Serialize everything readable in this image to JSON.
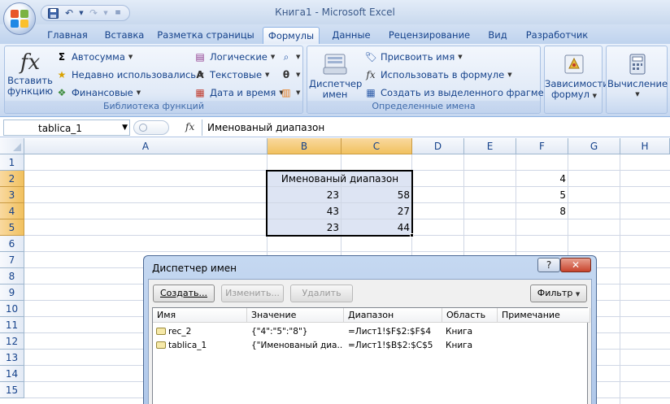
{
  "window": {
    "title": "Книга1 - Microsoft Excel"
  },
  "qat": {
    "save_icon": "save-icon",
    "undo_icon": "undo-icon",
    "redo_icon": "redo-icon",
    "customize_icon": "customize-icon"
  },
  "tabs": [
    {
      "label": "Главная"
    },
    {
      "label": "Вставка"
    },
    {
      "label": "Разметка страницы"
    },
    {
      "label": "Формулы",
      "active": true
    },
    {
      "label": "Данные"
    },
    {
      "label": "Рецензирование"
    },
    {
      "label": "Вид"
    },
    {
      "label": "Разработчик"
    }
  ],
  "ribbon": {
    "library": {
      "label": "Библиотека функций",
      "insert_function": "Вставить функцию",
      "insert_function_l1": "Вставить",
      "insert_function_l2": "функцию",
      "autosum": "Автосумма",
      "recent": "Недавно использовались",
      "financial": "Финансовые",
      "logical": "Логические",
      "text": "Текстовые",
      "datetime": "Дата и время"
    },
    "names": {
      "label": "Определенные имена",
      "manager_l1": "Диспетчер",
      "manager_l2": "имен",
      "define": "Присвоить имя",
      "use_in_formula": "Использовать в формуле",
      "create_from_selection": "Создать из выделенного фрагмента"
    },
    "dependencies": {
      "l1": "Зависимости",
      "l2": "формул"
    },
    "calculation": {
      "l1": "Вычисление"
    }
  },
  "formula_bar": {
    "name_box": "tablica_1",
    "fx": "fx",
    "formula": "Именованый диапазон"
  },
  "sheet": {
    "columns": [
      "A",
      "B",
      "C",
      "D",
      "E",
      "F",
      "G",
      "H"
    ],
    "rows": [
      "1",
      "2",
      "3",
      "4",
      "5",
      "6",
      "7",
      "8",
      "9",
      "10",
      "11",
      "12",
      "13",
      "14",
      "15"
    ],
    "cells": {
      "B2": "Именованый диапазон",
      "B3": "23",
      "C3": "58",
      "B4": "43",
      "C4": "27",
      "B5": "23",
      "C5": "44",
      "F2": "4",
      "F3": "5",
      "F4": "8"
    }
  },
  "dialog": {
    "title": "Диспетчер имен",
    "help": "?",
    "close": "✕",
    "buttons": {
      "create": "Создать...",
      "edit": "Изменить...",
      "delete": "Удалить",
      "filter": "Фильтр"
    },
    "columns": [
      "Имя",
      "Значение",
      "Диапазон",
      "Область",
      "Примечание"
    ],
    "rows": [
      {
        "name": "rec_2",
        "value": "{\"4\":\"5\":\"8\"}",
        "range": "=Лист1!$F$2:$F$4",
        "scope": "Книга",
        "note": ""
      },
      {
        "name": "tablica_1",
        "value": "{\"Именованый диа...",
        "range": "=Лист1!$B$2:$C$5",
        "scope": "Книга",
        "note": ""
      }
    ]
  }
}
